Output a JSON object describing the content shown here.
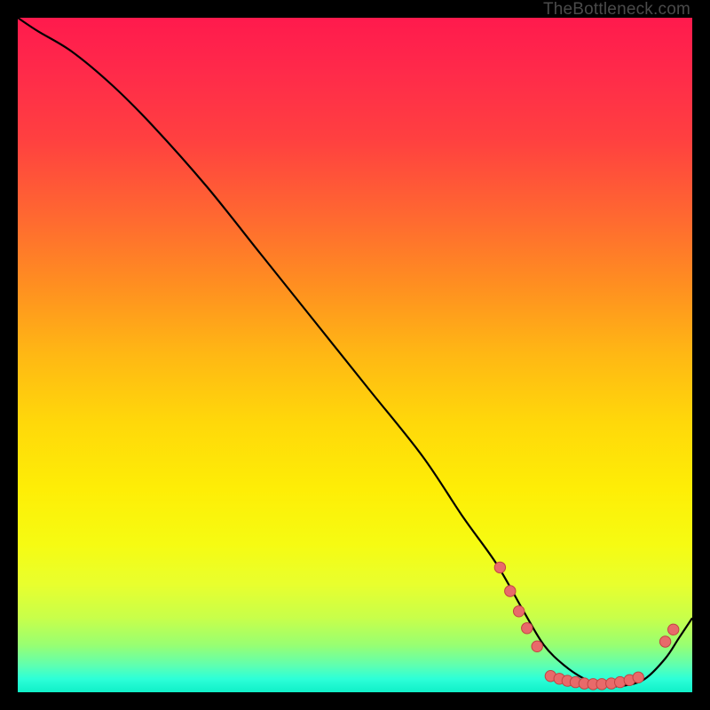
{
  "attribution": "TheBottleneck.com",
  "colors": {
    "frame": "#000000",
    "curve": "#000000",
    "dot_fill": "#e86a6a",
    "dot_stroke": "#c24343"
  },
  "chart_data": {
    "type": "line",
    "title": "",
    "xlabel": "",
    "ylabel": "",
    "xlim": [
      0,
      100
    ],
    "ylim": [
      0,
      100
    ],
    "x": [
      0,
      3,
      8,
      14,
      20,
      28,
      36,
      44,
      52,
      60,
      66,
      71,
      75,
      78,
      81,
      84,
      87,
      90,
      93,
      96,
      98,
      100
    ],
    "values": [
      100,
      98,
      95,
      90,
      84,
      75,
      65,
      55,
      45,
      35,
      26,
      19,
      12,
      7,
      4,
      2,
      1,
      1,
      2,
      5,
      8,
      11
    ],
    "dots": [
      {
        "x": 71.5,
        "y": 18.5
      },
      {
        "x": 73.0,
        "y": 15.0
      },
      {
        "x": 74.3,
        "y": 12.0
      },
      {
        "x": 75.5,
        "y": 9.5
      },
      {
        "x": 77.0,
        "y": 6.8
      },
      {
        "x": 79.0,
        "y": 2.4
      },
      {
        "x": 80.3,
        "y": 2.0
      },
      {
        "x": 81.5,
        "y": 1.7
      },
      {
        "x": 82.7,
        "y": 1.5
      },
      {
        "x": 84.0,
        "y": 1.3
      },
      {
        "x": 85.3,
        "y": 1.2
      },
      {
        "x": 86.6,
        "y": 1.2
      },
      {
        "x": 88.0,
        "y": 1.3
      },
      {
        "x": 89.3,
        "y": 1.5
      },
      {
        "x": 90.7,
        "y": 1.8
      },
      {
        "x": 92.0,
        "y": 2.2
      },
      {
        "x": 96.0,
        "y": 7.5
      },
      {
        "x": 97.2,
        "y": 9.3
      }
    ]
  }
}
